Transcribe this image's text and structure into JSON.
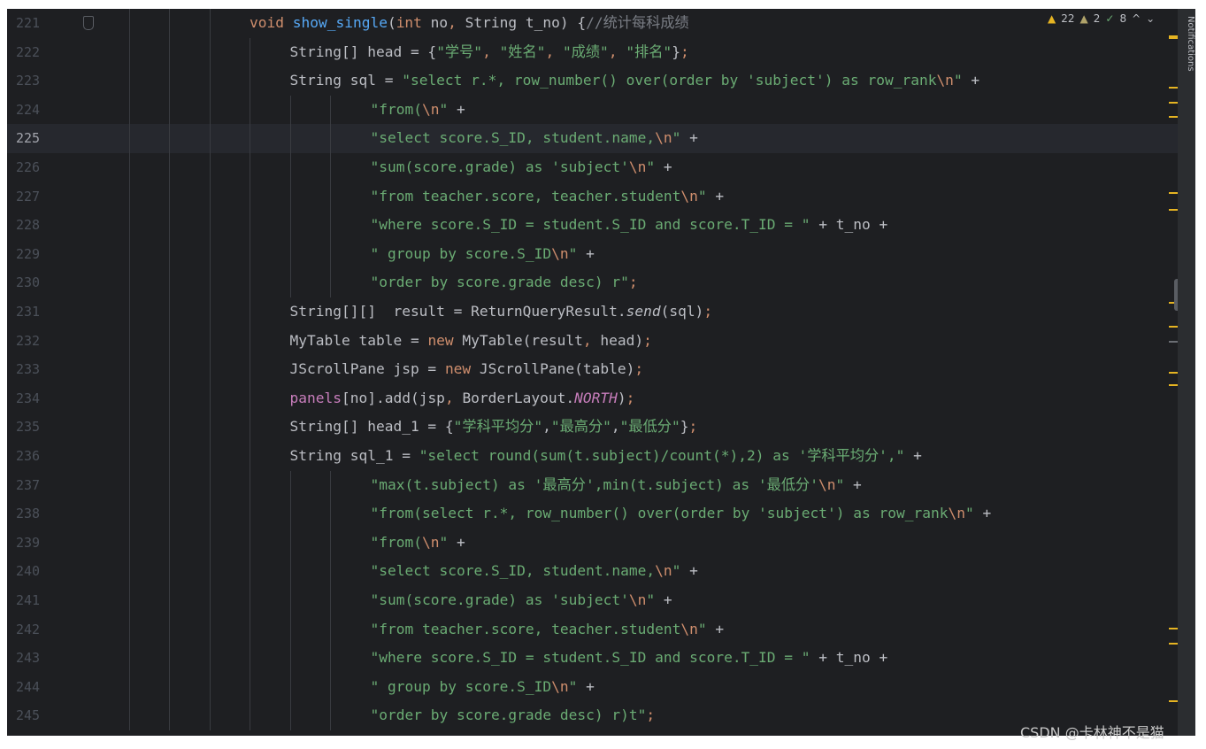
{
  "editor": {
    "inspection": {
      "warnings": "22",
      "weak_warnings": "2",
      "typos": "8",
      "up_arrow": "^",
      "down_arrow": "⌄"
    },
    "notifications_label": "Notifications",
    "lines": [
      {
        "n": "221",
        "tokens": [
          [
            "kw",
            "void "
          ],
          [
            "fn",
            "show_single"
          ],
          [
            "",
            "("
          ],
          [
            "kw",
            "int "
          ],
          [
            "",
            "no"
          ],
          [
            "kw",
            ", "
          ],
          [
            "",
            "String t_no) {"
          ],
          [
            "cmt",
            "//统计每科成绩"
          ]
        ]
      },
      {
        "n": "222",
        "tokens": [
          [
            "",
            "String[] head = {"
          ],
          [
            "str",
            "\"学号\""
          ],
          [
            "kw",
            ", "
          ],
          [
            "str",
            "\"姓名\""
          ],
          [
            "kw",
            ", "
          ],
          [
            "str",
            "\"成绩\""
          ],
          [
            "kw",
            ", "
          ],
          [
            "str",
            "\"排名\""
          ],
          [
            "",
            "}"
          ],
          [
            "kw",
            ";"
          ]
        ]
      },
      {
        "n": "223",
        "tokens": [
          [
            "",
            "String sql = "
          ],
          [
            "str",
            "\"select r.*, row_number() over(order by 'subject') as row_rank"
          ],
          [
            "esc",
            "\\n"
          ],
          [
            "str",
            "\""
          ],
          [
            "",
            " +"
          ]
        ]
      },
      {
        "n": "224",
        "tokens": [
          [
            "str",
            "\"from("
          ],
          [
            "esc",
            "\\n"
          ],
          [
            "str",
            "\""
          ],
          [
            "",
            " +"
          ]
        ]
      },
      {
        "n": "225",
        "tokens": [
          [
            "str",
            "\"select score.S_ID, student.name,"
          ],
          [
            "esc",
            "\\n"
          ],
          [
            "str",
            "\""
          ],
          [
            "",
            " +"
          ]
        ]
      },
      {
        "n": "226",
        "tokens": [
          [
            "str",
            "\"sum(score.grade) as 'subject'"
          ],
          [
            "esc",
            "\\n"
          ],
          [
            "str",
            "\""
          ],
          [
            "",
            " +"
          ]
        ]
      },
      {
        "n": "227",
        "tokens": [
          [
            "str",
            "\"from teacher.score, teacher.student"
          ],
          [
            "esc",
            "\\n"
          ],
          [
            "str",
            "\""
          ],
          [
            "",
            " +"
          ]
        ]
      },
      {
        "n": "228",
        "tokens": [
          [
            "str",
            "\"where score.S_ID = student.S_ID and score.T_ID = \""
          ],
          [
            "",
            " + t_no +"
          ]
        ]
      },
      {
        "n": "229",
        "tokens": [
          [
            "str",
            "\" group by score.S_ID"
          ],
          [
            "esc",
            "\\n"
          ],
          [
            "str",
            "\""
          ],
          [
            "",
            " +"
          ]
        ]
      },
      {
        "n": "230",
        "tokens": [
          [
            "str",
            "\"order by score.grade desc) r\""
          ],
          [
            "kw",
            ";"
          ]
        ]
      },
      {
        "n": "231",
        "tokens": [
          [
            "",
            "String[][]  result = ReturnQueryResult."
          ],
          [
            "italic",
            "send"
          ],
          [
            "",
            "(sql)"
          ],
          [
            "kw",
            ";"
          ]
        ]
      },
      {
        "n": "232",
        "tokens": [
          [
            "",
            "MyTable table = "
          ],
          [
            "kw",
            "new "
          ],
          [
            "",
            "MyTable(result"
          ],
          [
            "kw",
            ", "
          ],
          [
            "",
            "head)"
          ],
          [
            "kw",
            ";"
          ]
        ]
      },
      {
        "n": "233",
        "tokens": [
          [
            "",
            "JScrollPane jsp = "
          ],
          [
            "kw",
            "new "
          ],
          [
            "",
            "JScrollPane(table)"
          ],
          [
            "kw",
            ";"
          ]
        ]
      },
      {
        "n": "234",
        "tokens": [
          [
            "field",
            "panels"
          ],
          [
            "",
            "[no].add(jsp"
          ],
          [
            "kw",
            ", "
          ],
          [
            "",
            "BorderLayout."
          ],
          [
            "const",
            "NORTH"
          ],
          [
            "",
            ")"
          ],
          [
            "kw",
            ";"
          ]
        ]
      },
      {
        "n": "235",
        "tokens": [
          [
            "",
            "String[] head_1 = {"
          ],
          [
            "str",
            "\"学科平均分\""
          ],
          [
            "",
            ","
          ],
          [
            "str",
            "\"最高分\""
          ],
          [
            "",
            ","
          ],
          [
            "str",
            "\"最低分\""
          ],
          [
            "",
            "}"
          ],
          [
            "kw",
            ";"
          ]
        ]
      },
      {
        "n": "236",
        "tokens": [
          [
            "",
            "String sql_1 = "
          ],
          [
            "str",
            "\"select round(sum(t.subject)/count(*),2) as '学科平均分',\""
          ],
          [
            "",
            " +"
          ]
        ]
      },
      {
        "n": "237",
        "tokens": [
          [
            "str",
            "\"max(t.subject) as '最高分',min(t.subject) as '最低分'"
          ],
          [
            "esc",
            "\\n"
          ],
          [
            "str",
            "\""
          ],
          [
            "",
            " +"
          ]
        ]
      },
      {
        "n": "238",
        "tokens": [
          [
            "str",
            "\"from(select r.*, row_number() over(order by 'subject') as row_rank"
          ],
          [
            "esc",
            "\\n"
          ],
          [
            "str",
            "\""
          ],
          [
            "",
            " +"
          ]
        ]
      },
      {
        "n": "239",
        "tokens": [
          [
            "str",
            "\"from("
          ],
          [
            "esc",
            "\\n"
          ],
          [
            "str",
            "\""
          ],
          [
            "",
            " +"
          ]
        ]
      },
      {
        "n": "240",
        "tokens": [
          [
            "str",
            "\"select score.S_ID, student.name,"
          ],
          [
            "esc",
            "\\n"
          ],
          [
            "str",
            "\""
          ],
          [
            "",
            " +"
          ]
        ]
      },
      {
        "n": "241",
        "tokens": [
          [
            "str",
            "\"sum(score.grade) as 'subject'"
          ],
          [
            "esc",
            "\\n"
          ],
          [
            "str",
            "\""
          ],
          [
            "",
            " +"
          ]
        ]
      },
      {
        "n": "242",
        "tokens": [
          [
            "str",
            "\"from teacher.score, teacher.student"
          ],
          [
            "esc",
            "\\n"
          ],
          [
            "str",
            "\""
          ],
          [
            "",
            " +"
          ]
        ]
      },
      {
        "n": "243",
        "tokens": [
          [
            "str",
            "\"where score.S_ID = student.S_ID and score.T_ID = \""
          ],
          [
            "",
            " + t_no +"
          ]
        ]
      },
      {
        "n": "244",
        "tokens": [
          [
            "str",
            "\" group by score.S_ID"
          ],
          [
            "esc",
            "\\n"
          ],
          [
            "str",
            "\""
          ],
          [
            "",
            " +"
          ]
        ]
      },
      {
        "n": "245",
        "tokens": [
          [
            "str",
            "\"order by score.grade desc) r)t\""
          ],
          [
            "kw",
            ";"
          ]
        ]
      }
    ],
    "current_line": "225"
  },
  "watermark": "CSDN @卡林神不是猫",
  "colors": {
    "background": "#1e1f22",
    "keyword": "#cf8e6d",
    "string": "#6aab73",
    "function": "#56a8f5",
    "field": "#c77dbb",
    "warning": "#e6b422"
  }
}
